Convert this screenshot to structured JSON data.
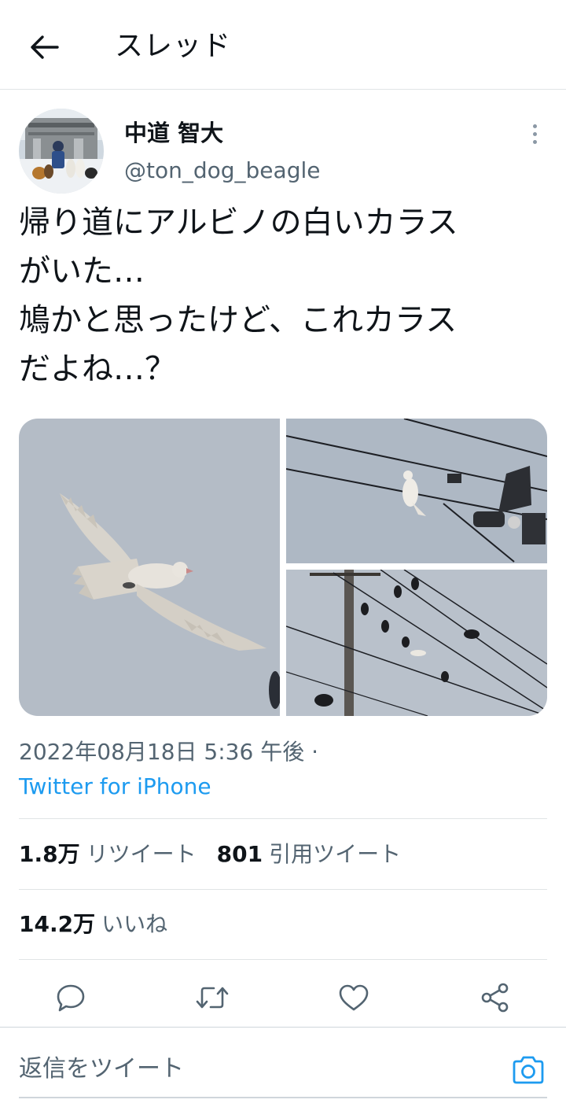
{
  "header": {
    "title": "スレッド",
    "back_icon": "arrow-left-icon"
  },
  "author": {
    "name": "中道 智大",
    "handle": "@ton_dog_beagle",
    "avatar_icon": "avatar-photo",
    "more_icon": "more-vertical-icon"
  },
  "tweet": {
    "text": "帰り道にアルビノの白いカラス\nがいた…\n鳩かと思ったけど、これカラス\nだよね…？"
  },
  "media": {
    "photos": [
      {
        "subject": "white-crow-flying-photo"
      },
      {
        "subject": "white-crow-on-wire-photo"
      },
      {
        "subject": "crows-on-power-lines-photo"
      }
    ]
  },
  "meta": {
    "timestamp": "2022年08月18日 5:36 午後 ·",
    "source": "Twitter for iPhone"
  },
  "stats": {
    "retweets_count": "1.8万",
    "retweets_label": "リツイート",
    "quotes_count": "801",
    "quotes_label": "引用ツイート",
    "likes_count": "14.2万",
    "likes_label": "いいね"
  },
  "actions": [
    "reply-icon",
    "retweet-icon",
    "like-icon",
    "share-icon"
  ],
  "reply": {
    "placeholder": "返信をツイート",
    "camera_icon": "camera-icon"
  },
  "colors": {
    "text": "#0f1419",
    "secondary": "#536471",
    "link": "#1d9bf0",
    "divider": "#e1e4e6"
  }
}
